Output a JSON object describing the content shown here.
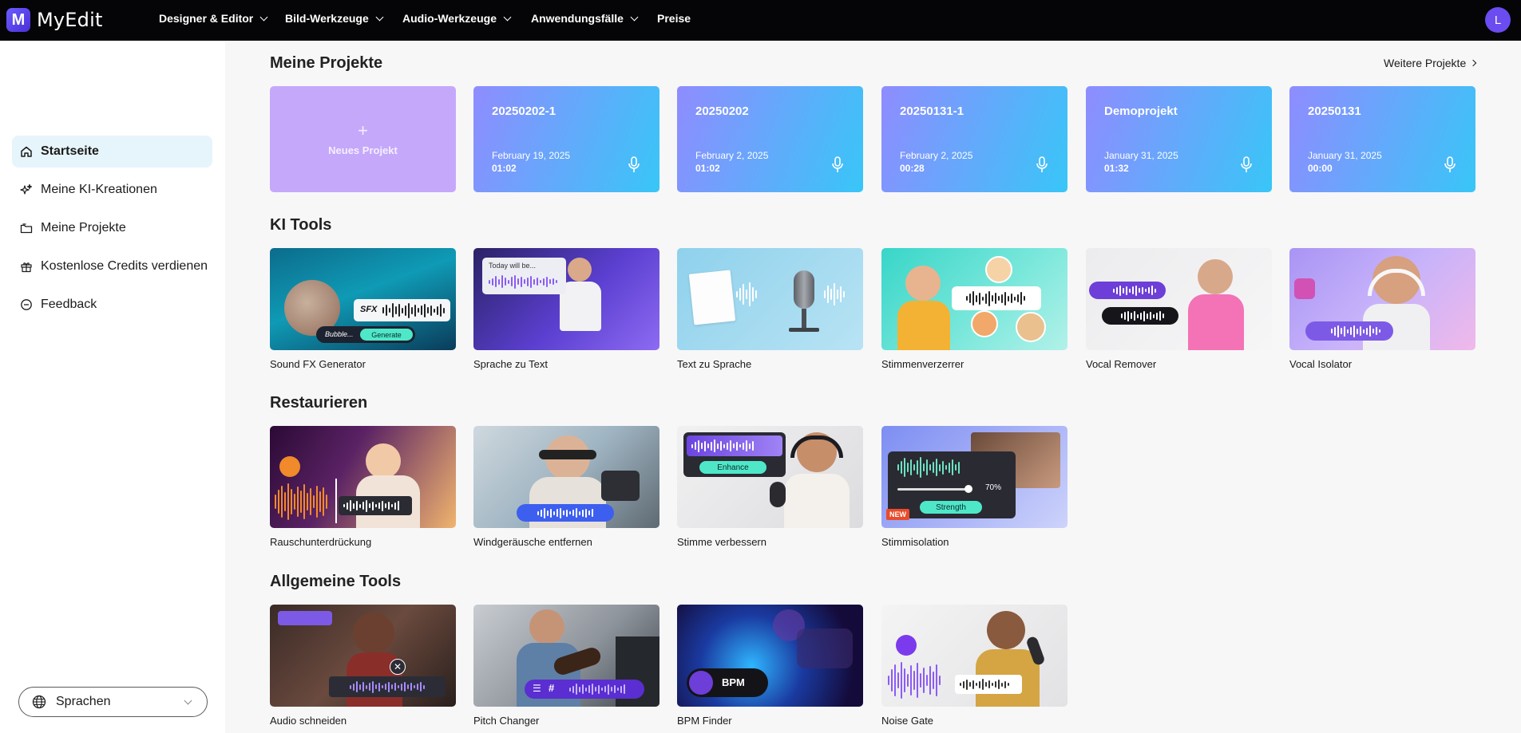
{
  "app": {
    "logo_text": "MyEdit",
    "logo_mark": "M",
    "avatar_initial": "L"
  },
  "nav": [
    {
      "label": "Designer & Editor"
    },
    {
      "label": "Bild-Werkzeuge"
    },
    {
      "label": "Audio-Werkzeuge"
    },
    {
      "label": "Anwendungsfälle"
    },
    {
      "label": "Preise"
    }
  ],
  "sidebar": {
    "items": [
      {
        "label": "Startseite",
        "icon": "home-icon"
      },
      {
        "label": "Meine KI-Kreationen",
        "icon": "sparkle-icon"
      },
      {
        "label": "Meine Projekte",
        "icon": "folder-icon"
      },
      {
        "label": "Kostenlose Credits verdienen",
        "icon": "gift-icon"
      },
      {
        "label": "Feedback",
        "icon": "feedback-icon"
      }
    ],
    "language_label": "Sprachen"
  },
  "projects": {
    "title": "Meine Projekte",
    "more_label": "Weitere Projekte",
    "new_label": "Neues Projekt",
    "items": [
      {
        "name": "20250202-1",
        "date": "February 19, 2025",
        "duration": "01:02"
      },
      {
        "name": "20250202",
        "date": "February 2, 2025",
        "duration": "01:02"
      },
      {
        "name": "20250131-1",
        "date": "February 2, 2025",
        "duration": "00:28"
      },
      {
        "name": "Demoprojekt",
        "date": "January 31, 2025",
        "duration": "01:32"
      },
      {
        "name": "20250131",
        "date": "January 31, 2025",
        "duration": "00:00"
      }
    ]
  },
  "ki_tools": {
    "title": "KI Tools",
    "items": [
      {
        "label": "Sound FX Generator",
        "badge": "SFX",
        "prompt": "Bubble...",
        "button": "Generate"
      },
      {
        "label": "Sprache zu Text",
        "caption": "Today will be..."
      },
      {
        "label": "Text zu Sprache"
      },
      {
        "label": "Stimmenverzerrer"
      },
      {
        "label": "Vocal Remover"
      },
      {
        "label": "Vocal Isolator"
      }
    ]
  },
  "restore": {
    "title": "Restaurieren",
    "items": [
      {
        "label": "Rauschunterdrückung"
      },
      {
        "label": "Windgeräusche entfernen"
      },
      {
        "label": "Stimme verbessern",
        "button": "Enhance"
      },
      {
        "label": "Stimmisolation",
        "button": "Strength",
        "percent": "70%",
        "badge": "NEW"
      }
    ]
  },
  "general": {
    "title": "Allgemeine Tools",
    "items": [
      {
        "label": "Audio schneiden"
      },
      {
        "label": "Pitch Changer"
      },
      {
        "label": "BPM Finder",
        "badge": "BPM"
      },
      {
        "label": "Noise Gate"
      }
    ]
  },
  "colors": {
    "topbar": "#050507",
    "accent": "#6a4cf0",
    "active_bg": "#e6f5fb",
    "project_gradient_start": "#8f8cff",
    "project_gradient_end": "#38c6f7",
    "new_project": "#c6a8fb"
  }
}
